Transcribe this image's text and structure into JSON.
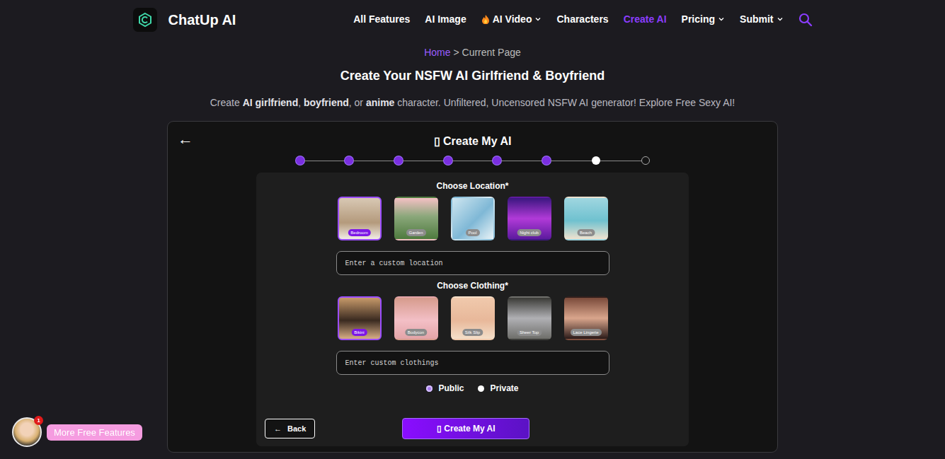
{
  "brand": {
    "name": "ChatUp AI"
  },
  "nav": [
    {
      "label": "All Features",
      "selected": false,
      "dropdown": false,
      "flame": false
    },
    {
      "label": "AI Image",
      "selected": false,
      "dropdown": false,
      "flame": false
    },
    {
      "label": "AI Video",
      "selected": false,
      "dropdown": true,
      "flame": true
    },
    {
      "label": "Characters",
      "selected": false,
      "dropdown": false,
      "flame": false
    },
    {
      "label": "Create AI",
      "selected": true,
      "dropdown": false,
      "flame": false
    },
    {
      "label": "Pricing",
      "selected": false,
      "dropdown": true,
      "flame": false
    },
    {
      "label": "Submit",
      "selected": false,
      "dropdown": true,
      "flame": false
    }
  ],
  "breadcrumb": {
    "home": "Home",
    "separator": ">",
    "current": "Current Page"
  },
  "title": "Create Your NSFW AI Girlfriend & Boyfriend",
  "subtitle": [
    {
      "text": "Create ",
      "bold": false
    },
    {
      "text": "AI girlfriend",
      "bold": true
    },
    {
      "text": ", ",
      "bold": false
    },
    {
      "text": "boyfriend",
      "bold": true
    },
    {
      "text": ", or ",
      "bold": false
    },
    {
      "text": "anime",
      "bold": true
    },
    {
      "text": " character. Unfiltered, Uncensored NSFW AI generator! Explore Free Sexy AI!",
      "bold": false
    }
  ],
  "wizard": {
    "back_icon": "←",
    "title_icon": "▯",
    "title": "Create My AI",
    "steps": [
      {
        "completed": true,
        "selected": false
      },
      {
        "completed": true,
        "selected": false
      },
      {
        "completed": true,
        "selected": false
      },
      {
        "completed": true,
        "selected": false
      },
      {
        "completed": true,
        "selected": false
      },
      {
        "completed": true,
        "selected": false
      },
      {
        "completed": false,
        "selected": true
      },
      {
        "completed": false,
        "selected": false
      }
    ]
  },
  "location": {
    "label": "Choose Location*",
    "placeholder": "Enter a custom location",
    "options": [
      {
        "label": "Bedroom",
        "selected": true
      },
      {
        "label": "Garden",
        "selected": false
      },
      {
        "label": "Pool",
        "selected": false
      },
      {
        "label": "Night club",
        "selected": false
      },
      {
        "label": "Beach",
        "selected": false
      }
    ]
  },
  "clothing": {
    "label": "Choose Clothing*",
    "placeholder": "Enter custom clothings",
    "options": [
      {
        "label": "Bikini",
        "selected": true
      },
      {
        "label": "Bodycon",
        "selected": false
      },
      {
        "label": "Silk Slip",
        "selected": false
      },
      {
        "label": "Sheer Top",
        "selected": false
      },
      {
        "label": "Lace Lingerie",
        "selected": false
      }
    ]
  },
  "visibility": [
    {
      "label": "Public",
      "selected": true
    },
    {
      "label": "Private",
      "selected": false
    }
  ],
  "buttons": {
    "back": {
      "icon": "←",
      "label": "Back"
    },
    "create": {
      "icon": "▯",
      "label": "Create My AI"
    }
  },
  "promo": {
    "badge": "1",
    "label": "More Free Features"
  }
}
